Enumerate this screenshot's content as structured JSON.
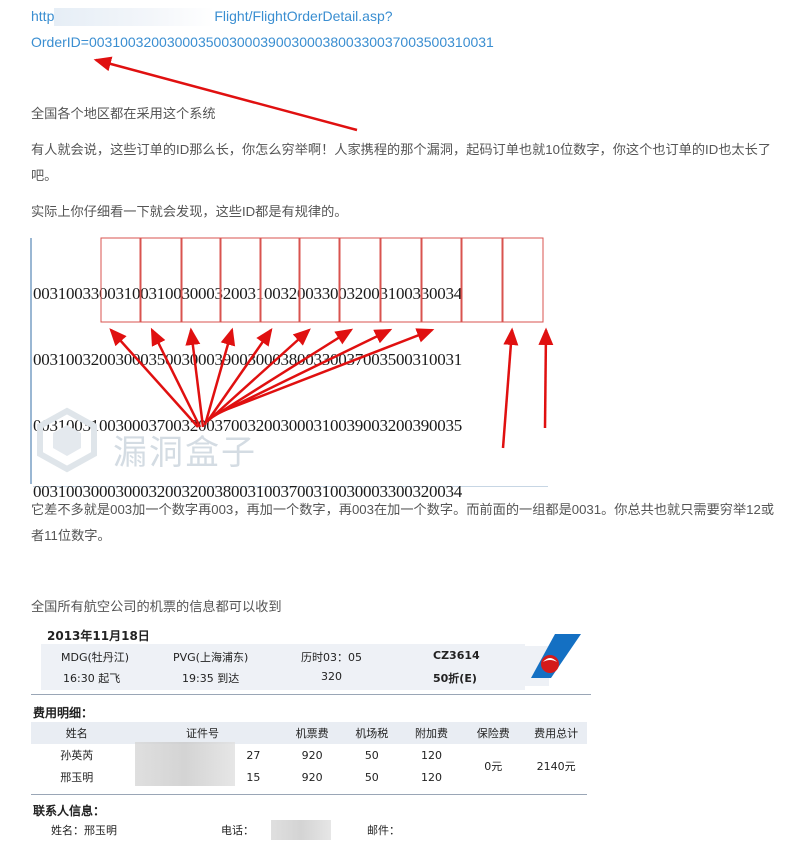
{
  "url": {
    "prefix": "http",
    "path": "Flight/FlightOrderDetail.asp?",
    "query": "OrderID=0031003200300035003000390030003800330037003500310031"
  },
  "paragraphs": {
    "p1": "全国各个地区都在采用这个系统",
    "p2": "有人就会说，这些订单的ID那么长，你怎么穷举啊！人家携程的那个漏洞，起码订单也就10位数字，你这个也订单的ID也太长了吧。",
    "p3": "实际上你仔细看一下就会发现，这些ID都是有规律的。",
    "p4": "它差不多就是003加一个数字再003，再加一个数字，再003在加一个数字。而前面的一组都是0031。你总共也就只需要穷举12或者11位数字。",
    "p5": "全国所有航空公司的机票的信息都可以收到"
  },
  "id_rows": [
    "0031003300310031003000320031003200330032003100330034",
    "0031003200300035003000390030003800330037003500310031",
    "0031003100300037003200370032003000310039003200390035",
    "0031003000300032003200380031003700310030003300320034"
  ],
  "watermark": {
    "text": "漏洞盒子"
  },
  "ticket": {
    "date": "2013年11月18日",
    "dep_airport": "MDG(牡丹江)",
    "arr_airport": "PVG(上海浦东)",
    "duration": "历时03：05",
    "flight_no": "CZ3614",
    "dep_time": "16:30 起飞",
    "arr_time": "19:35 到达",
    "distance": "320",
    "discount": "50折(E)",
    "fee_title": "费用明细：",
    "fee_headers": [
      "姓名",
      "证件号",
      "机票费",
      "机场税",
      "附加费",
      "保险费",
      "费用总计"
    ],
    "passengers": [
      {
        "name": "孙英芮",
        "id_tail": "27",
        "ticket": "920",
        "tax": "50",
        "extra": "120"
      },
      {
        "name": "邢玉明",
        "id_tail": "15",
        "ticket": "920",
        "tax": "50",
        "extra": "120"
      }
    ],
    "insurance": "0元",
    "total": "2140元",
    "contact_title": "联系人信息：",
    "contact_name_label": "姓名：",
    "contact_name": "邢玉明",
    "phone_label": "电话：",
    "email_label": "邮件："
  },
  "colors": {
    "link": "#3a8ed1",
    "arrow": "#e01010",
    "box": "#d9534f",
    "logo_blue": "#1470c3",
    "logo_red": "#d41a1a"
  }
}
